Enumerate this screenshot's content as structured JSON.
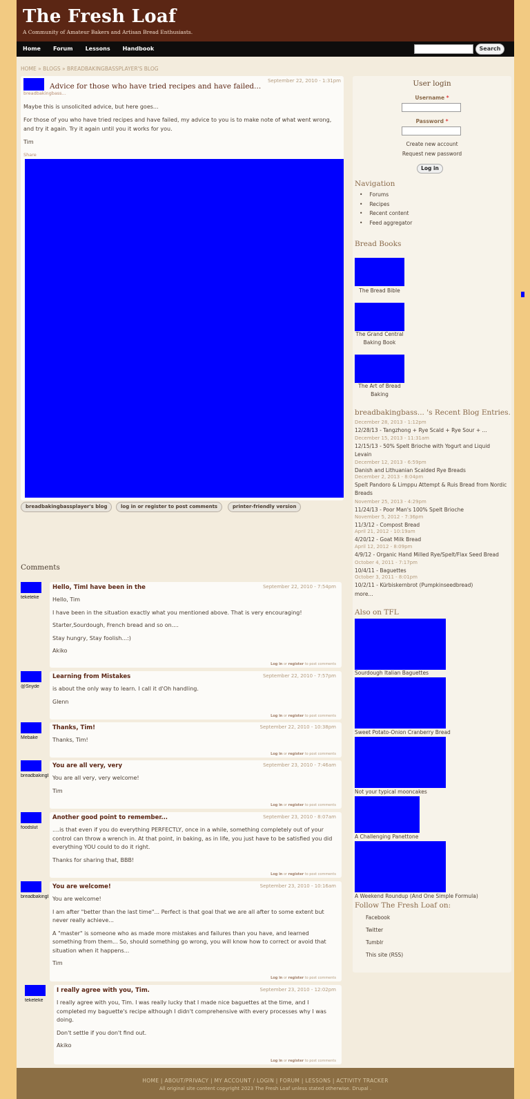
{
  "header": {
    "site_name": "The Fresh Loaf",
    "slogan": "A Community of Amateur Bakers and Artisan Bread Enthusiasts."
  },
  "navbar": {
    "items": [
      "Home",
      "Forum",
      "Lessons",
      "Handbook"
    ],
    "search_value": "",
    "search_button": "Search"
  },
  "breadcrumb": "HOME » BLOGS » BREADBAKINGBASSPLAYER'S BLOG",
  "node": {
    "author": "breadbakingbass...",
    "title": "Advice for those who have tried recipes and have failed...",
    "date": "September 22, 2010 - 1:31pm",
    "body": [
      "Maybe this is unsolicited advice, but here goes...",
      "For those of you who have tried recipes and have failed, my advice to you is to make note of what went wrong, and try it again. Try it again until you it works for you.",
      "Tim"
    ],
    "share": "Share",
    "links": [
      "breadbakingbassplayer's blog",
      "log in or register to post comments",
      "printer-friendly version"
    ]
  },
  "comments": {
    "title": "Comments",
    "link_login": "Log in",
    "link_or": "or",
    "link_register": "register",
    "link_suffix": "to post comments",
    "items": [
      {
        "author": "teketeke",
        "title": "Hello, TimI have been in the",
        "date": "September 22, 2010 - 7:54pm",
        "body": [
          "Hello, Tim",
          "I have been in the situation exactly what you mentioned above. That is very encouraging!",
          "Starter,Sourdough, French bread and so on....",
          "Stay hungry, Stay foolish...:)",
          "Akiko"
        ]
      },
      {
        "author": "@Snyde",
        "title": "Learning from Mistakes",
        "date": "September 22, 2010 - 7:57pm",
        "body": [
          "is about the only way to learn.  I call it d'Oh handling.",
          "Glenn"
        ]
      },
      {
        "author": "Mebake",
        "title": "Thanks, Tim!",
        "date": "September 22, 2010 - 10:38pm",
        "body": [
          "Thanks, Tim!"
        ]
      },
      {
        "author": "breadbakingbassplayer",
        "title": "You are all very, very",
        "date": "September 23, 2010 - 7:46am",
        "body": [
          "You are all very, very welcome!",
          "Tim"
        ]
      },
      {
        "author": "foodslut",
        "title": "Another good point to remember...",
        "date": "September 23, 2010 - 8:07am",
        "body": [
          "....is that even if you do everything PERFECTLY, once in a while, something completely out of your control can throw a wrench in.  At that point, in baking, as in life, you just have to be satisfied you did everything YOU could to do it right.",
          "Thanks for sharing that, BBB!"
        ]
      },
      {
        "author": "breadbakingbassplayer",
        "title": "You are welcome!",
        "date": "September 23, 2010 - 10:16am",
        "body": [
          "You are welcome!",
          "I am after \"better than the last time\"...  Perfect is that goal that we are all after to some extent but never really achieve...",
          "A \"master\" is someone who as made more mistakes and failures than you have, and learned something from them...    So, should something go wrong, you will know how to correct or avoid that situation when it happens...",
          "Tim"
        ]
      },
      {
        "author": "teketeke",
        "title": "I really agree with you, Tim.",
        "date": "September 23, 2010 - 12:02pm",
        "body": [
          "I really agree with you, Tim. I was really lucky that I made nice baguettes at the time, and  I completed my baguette's recipe although I didn't comprehensive with every processes why I was doing.",
          "Don't settle if you don't find out.",
          "Akiko"
        ]
      }
    ]
  },
  "sidebar": {
    "login": {
      "title": "User login",
      "username_label": "Username",
      "password_label": "Password",
      "required_mark": "*",
      "create_account": "Create new account",
      "request_password": "Request new password",
      "login_button": "Log in"
    },
    "navigation": {
      "title": "Navigation",
      "items": [
        "Forums",
        "Recipes",
        "Recent content",
        "Feed aggregator"
      ]
    },
    "books": {
      "title": "Bread Books",
      "items": [
        "The Bread Bible",
        "The Grand Central Baking Book",
        "The Art of Bread Baking"
      ]
    },
    "recent": {
      "title": "breadbakingbass... 's Recent Blog Entries.",
      "items": [
        {
          "date": "December 28, 2013 - 1:12pm",
          "title": "12/28/13 - Tangzhong + Rye Scald + Rye Sour + ..."
        },
        {
          "date": "December 15, 2013 - 11:31am",
          "title": "12/15/13 - 50% Spelt Brioche with Yogurt and Liquid Levain"
        },
        {
          "date": "December 12, 2013 - 6:59pm",
          "title": "Danish and Lithuanian Scalded Rye Breads"
        },
        {
          "date": "December 2, 2013 - 8:04pm",
          "title": "Spelt Pandoro & Limppu Attempt & Ruis Bread from Nordic Breads"
        },
        {
          "date": "November 25, 2013 - 4:29pm",
          "title": "11/24/13 - Poor Man's 100% Spelt Brioche"
        },
        {
          "date": "November 5, 2012 - 7:36pm",
          "title": "11/3/12 - Compost Bread"
        },
        {
          "date": "April 21, 2012 - 10:19am",
          "title": "4/20/12 - Goat Milk Bread"
        },
        {
          "date": "April 12, 2012 - 8:09pm",
          "title": "4/9/12 - Organic Hand Milled Rye/Spelt/Flax Seed Bread"
        },
        {
          "date": "October 4, 2011 - 7:17pm",
          "title": "10/4/11 - Baguettes"
        },
        {
          "date": "October 3, 2011 - 8:01pm",
          "title": "10/2/11 - Kürbiskernbrot (Pumpkinseedbread)"
        }
      ],
      "more": "more..."
    },
    "also": {
      "title": "Also on TFL",
      "items": [
        "Sourdough Italian Baguettes",
        "Sweet Potato-Onion Cranberry Bread",
        "Not your typical mooncakes",
        "A Challenging Panettone",
        "A Weekend Roundup (And One Simple Formula)"
      ]
    },
    "follow": {
      "title": "Follow The Fresh Loaf on:",
      "items": [
        "Facebook",
        "Twitter",
        "Tumblr",
        "This site (RSS)"
      ]
    }
  },
  "footer": {
    "links": "HOME | ABOUT/PRIVACY | MY ACCOUNT / LOGIN | FORUM | LESSONS | ACTIVITY TRACKER",
    "copyright": "All original site content copyright 2023 The Fresh Loaf unless stated otherwise. Drupal ."
  },
  "colors": {
    "outer_bg": "#f2ca82",
    "header_bg": "#5b2614",
    "navbar_bg": "#0e0d0c",
    "footer_bg": "#8b6e44",
    "image_placeholder": "#0000ff"
  }
}
